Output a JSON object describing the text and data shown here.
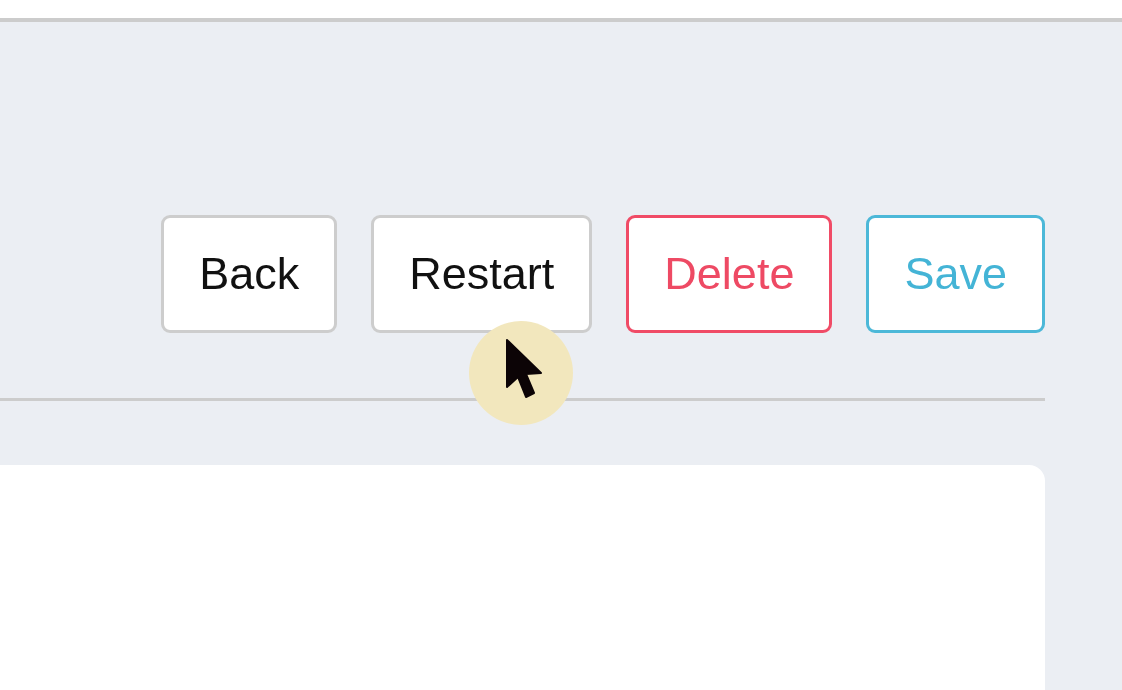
{
  "toolbar": {
    "buttons": [
      {
        "label": "Back",
        "kind": "default"
      },
      {
        "label": "Restart",
        "kind": "default"
      },
      {
        "label": "Delete",
        "kind": "danger"
      },
      {
        "label": "Save",
        "kind": "primary"
      }
    ]
  }
}
